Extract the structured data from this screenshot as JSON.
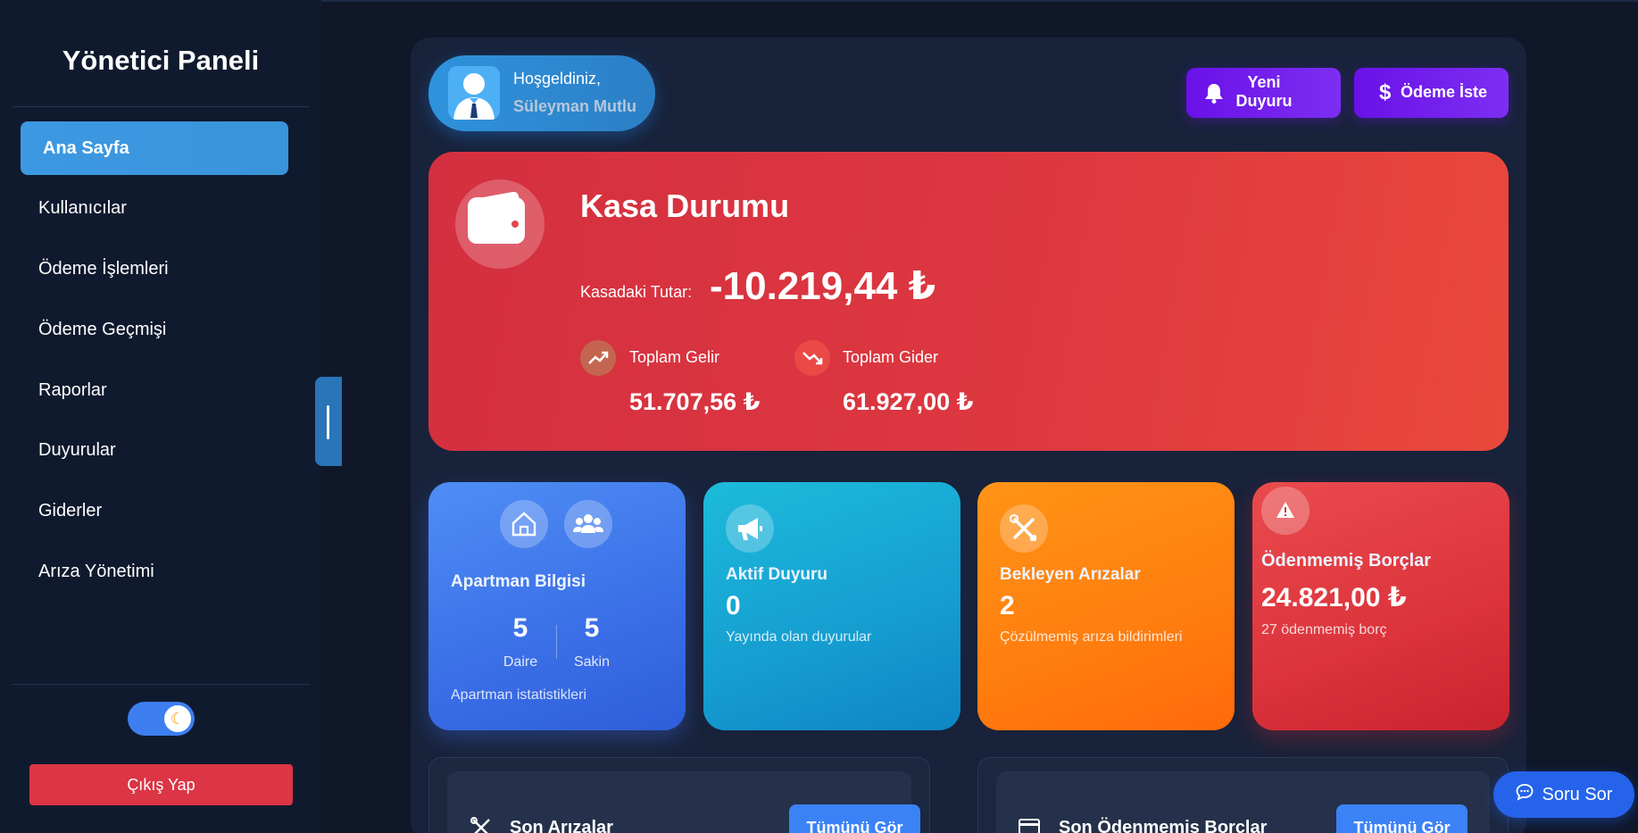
{
  "sidebar": {
    "title": "Yönetici Paneli",
    "items": [
      {
        "label": "Ana Sayfa"
      },
      {
        "label": "Kullanıcılar"
      },
      {
        "label": "Ödeme İşlemleri"
      },
      {
        "label": "Ödeme Geçmişi"
      },
      {
        "label": "Raporlar"
      },
      {
        "label": "Duyurular"
      },
      {
        "label": "Giderler"
      },
      {
        "label": "Arıza Yönetimi"
      }
    ],
    "active_item": "Ana Sayfa",
    "theme_toggle": {
      "state": "dark",
      "icon": "moon-icon"
    },
    "logout_label": "Çıkış Yap"
  },
  "header": {
    "greeting": "Hoşgeldiniz,",
    "user_name": "Süleyman Mutlu",
    "buttons": {
      "announce_label_line1": "Yeni",
      "announce_label_line2": "Duyuru",
      "payment_label": "Ödeme İste"
    }
  },
  "kasa": {
    "title": "Kasa Durumu",
    "amount_label": "Kasadaki Tutar:",
    "amount": "-10.219,44 ₺",
    "income_label": "Toplam Gelir",
    "income_value": "51.707,56 ₺",
    "expense_label": "Toplam Gider",
    "expense_value": "61.927,00 ₺"
  },
  "cards": {
    "apartment": {
      "title": "Apartman Bilgisi",
      "flats_value": "5",
      "flats_label": "Daire",
      "residents_value": "5",
      "residents_label": "Sakin",
      "subtitle": "Apartman istatistikleri"
    },
    "announcements": {
      "title": "Aktif Duyuru",
      "value": "0",
      "subtitle": "Yayında olan duyurular"
    },
    "faults": {
      "title": "Bekleyen Arızalar",
      "value": "2",
      "subtitle": "Çözülmemiş arıza bildirimleri"
    },
    "debts": {
      "title": "Ödenmemiş Borçlar",
      "value": "24.821,00 ₺",
      "subtitle": "27 ödenmemiş borç"
    }
  },
  "sections": {
    "recent_faults": {
      "title": "Son Arızalar",
      "button": "Tümünü Gör"
    },
    "recent_debts": {
      "title": "Son Ödenmemiş Borçlar",
      "button": "Tümünü Gör"
    }
  },
  "chat_button": "Soru Sor",
  "colors": {
    "background": "#0f1729",
    "sidebar_active": "#3d98e3",
    "kasa": "#dc3540",
    "accent_purple": "#6a11e8",
    "logout": "#dc3545"
  }
}
